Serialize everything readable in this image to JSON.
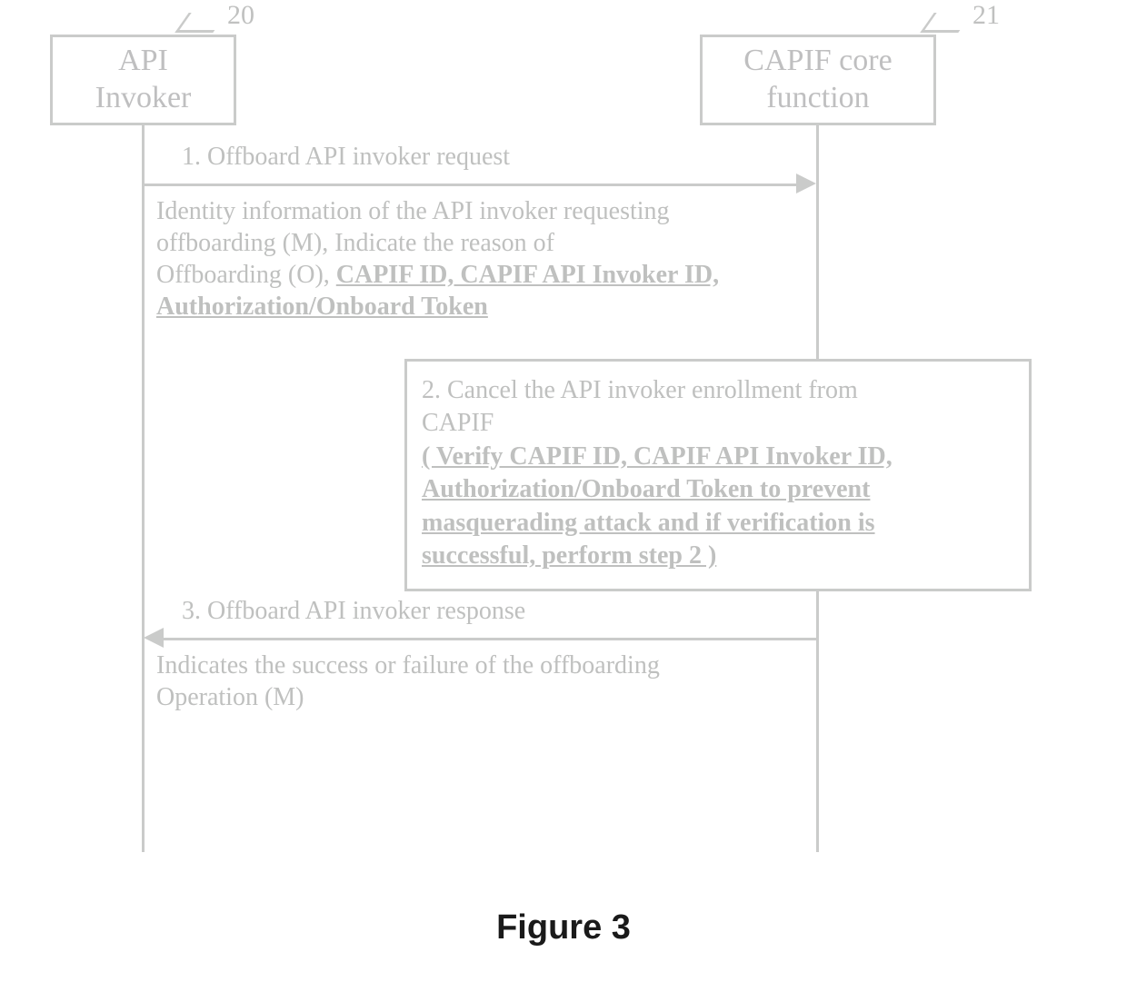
{
  "refs": {
    "invoker": "20",
    "capif": "21"
  },
  "actors": {
    "invoker_line1": "API",
    "invoker_line2": "Invoker",
    "capif_line1": "CAPIF core",
    "capif_line2": "function"
  },
  "messages": {
    "m1_title": "1.    Offboard API invoker request",
    "m1_body_plain_a": "Identity information of the API invoker requesting",
    "m1_body_plain_b": "offboarding (M), Indicate the reason of",
    "m1_body_plain_c": "Offboarding (O), ",
    "m1_body_bold_a": "CAPIF ID, CAPIF API Invoker ID,",
    "m1_body_bold_b": "Authorization/Onboard Token",
    "m2_title": "2. Cancel the API invoker enrollment  from",
    "m2_title_b": "CAPIF",
    "m2_bold_a": "( Verify CAPIF ID, CAPIF API Invoker ID,",
    "m2_bold_b": "Authorization/Onboard Token to prevent",
    "m2_bold_c": "masquerading attack and if verification is",
    "m2_bold_d": "successful, perform step 2 )",
    "m3_title": "3. Offboard API invoker response",
    "m3_body_a": "Indicates the success or failure of the offboarding",
    "m3_body_b": "Operation (M)"
  },
  "caption": "Figure 3"
}
